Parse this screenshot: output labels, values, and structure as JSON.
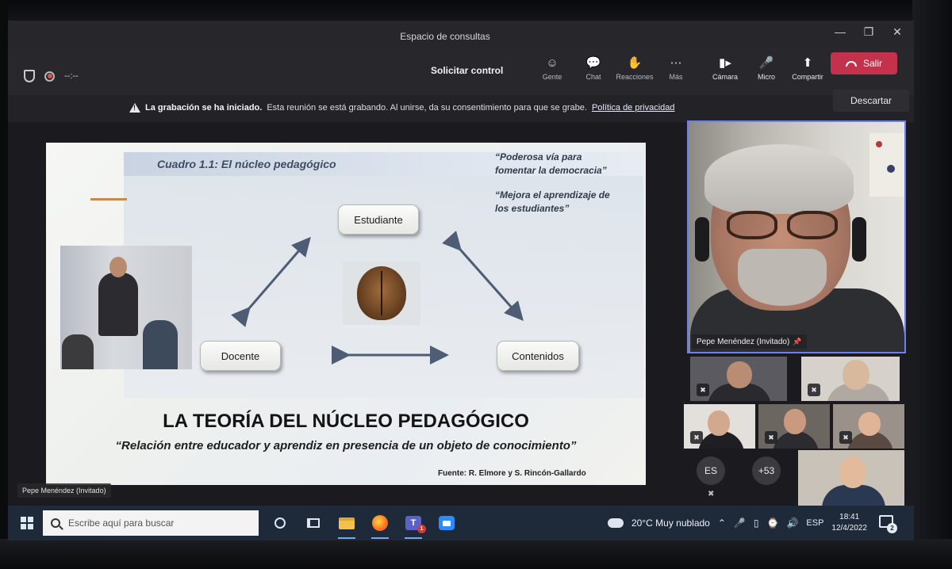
{
  "window": {
    "title": "Espacio de consultas",
    "controls": [
      "minimize",
      "restore",
      "close"
    ]
  },
  "toolbar": {
    "timer": "--:--",
    "request_control": "Solicitar control",
    "dim_items": [
      {
        "label": "Gente",
        "icon": "people-icon"
      },
      {
        "label": "Chat",
        "icon": "chat-icon"
      },
      {
        "label": "Reacciones",
        "icon": "reactions-icon"
      },
      {
        "label": "Más",
        "icon": "more-icon"
      }
    ],
    "light_items": [
      {
        "label": "Cámara",
        "icon": "camera-icon"
      },
      {
        "label": "Micro",
        "icon": "mic-off-icon"
      },
      {
        "label": "Compartir",
        "icon": "share-icon"
      }
    ],
    "leave": "Salir"
  },
  "banner": {
    "strong": "La grabación se ha iniciado.",
    "text": "Esta reunión se está grabando. Al unirse, da su consentimiento para que se grabe.",
    "link": "Política de privacidad",
    "dismiss": "Descartar"
  },
  "slide": {
    "header": "Cuadro 1.1: El núcleo pedagógico",
    "quote1_line1": "“Poderosa vía para",
    "quote1_line2": "fomentar la democracia”",
    "quote2_line1": "“Mejora el aprendizaje de",
    "quote2_line2": "los estudiantes”",
    "node_student": "Estudiante",
    "node_teacher": "Docente",
    "node_content": "Contenidos",
    "title": "LA TEORÍA DEL NÚCLEO PEDAGÓGICO",
    "subtitle": "“Relación entre educador y aprendiz en presencia de un objeto de conocimiento”",
    "source": "Fuente: R. Elmore y S. Rincón-Gallardo"
  },
  "presenter_label": "Pepe Menéndez (Invitado)",
  "pinned": {
    "name": "Pepe Menéndez (Invitado)"
  },
  "participants": {
    "avatar_initials": "ES",
    "more_count": "+53"
  },
  "taskbar": {
    "search_placeholder": "Escribe aquí para buscar",
    "weather": "20°C  Muy nublado",
    "language": "ESP",
    "time": "18:41",
    "date": "12/4/2022",
    "notifications": "2",
    "teams_badge": "1"
  },
  "colors": {
    "leave_button": "#c4314b",
    "pinned_border": "#6b7ff0",
    "teams": "#5b61c6",
    "taskbar": "#1e2a3a"
  }
}
